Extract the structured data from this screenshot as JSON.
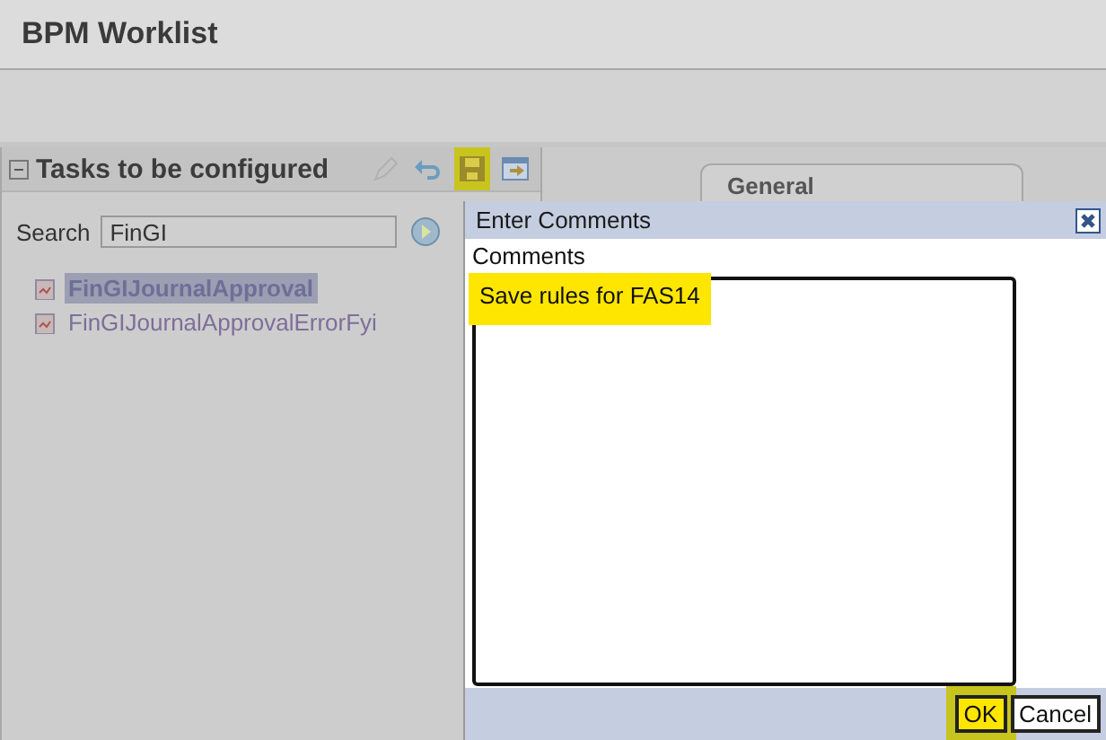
{
  "header": {
    "title": "BPM Worklist"
  },
  "tasks_panel": {
    "title": "Tasks to be configured",
    "expanded": true,
    "toolbar": [
      {
        "kind": "edit",
        "highlighted": false
      },
      {
        "kind": "undo",
        "highlighted": false
      },
      {
        "kind": "save",
        "highlighted": true
      },
      {
        "kind": "export",
        "highlighted": false
      }
    ],
    "search": {
      "label": "Search",
      "value": "FinGI"
    },
    "tree": [
      {
        "label": "FinGIJournalApproval",
        "selected": true
      },
      {
        "label": "FinGIJournalApprovalErrorFyi",
        "selected": false
      }
    ]
  },
  "detail": {
    "tab": "General"
  },
  "dialog": {
    "title": "Enter Comments",
    "field_label": "Comments",
    "value": "Save rules for FAS14",
    "value_highlighted": true,
    "buttons": [
      {
        "label": "OK",
        "highlighted": true
      },
      {
        "label": "Cancel",
        "highlighted": false
      }
    ]
  }
}
